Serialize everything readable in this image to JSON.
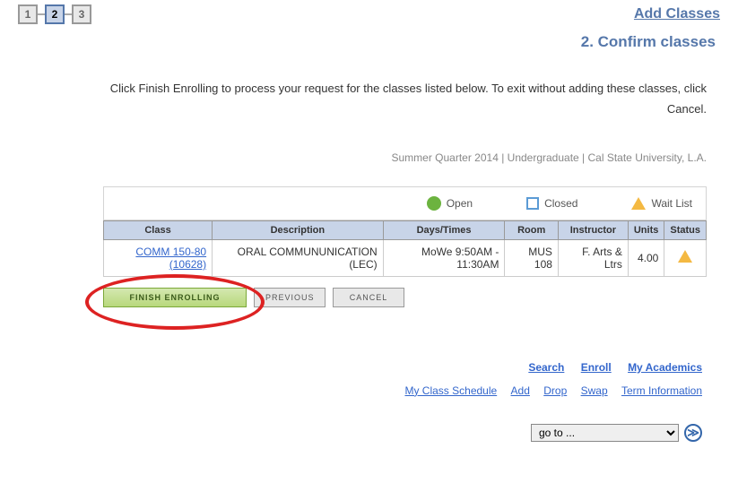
{
  "header": {
    "title": "Add Classes",
    "steps": [
      "1",
      "2",
      "3"
    ],
    "activeStep": 1
  },
  "subtitle": "2.  Confirm classes",
  "instructions": "Click Finish Enrolling to process your request for the classes listed below. To exit without adding these classes, click Cancel.",
  "termInfo": "Summer Quarter 2014 | Undergraduate | Cal State University, L.A.",
  "legend": {
    "open": "Open",
    "closed": "Closed",
    "waitlist": "Wait List"
  },
  "table": {
    "headers": {
      "class": "Class",
      "description": "Description",
      "daysTimes": "Days/Times",
      "room": "Room",
      "instructor": "Instructor",
      "units": "Units",
      "status": "Status"
    },
    "rows": [
      {
        "class": "COMM 150-80 (10628)",
        "description": "ORAL COMMUNUNICATION (LEC)",
        "daysTimes": "MoWe 9:50AM - 11:30AM",
        "room": "MUS 108",
        "instructor": "F. Arts & Ltrs",
        "units": "4.00",
        "status": "waitlist"
      }
    ]
  },
  "buttons": {
    "cancel": "CANCEL",
    "previous": "PREVIOUS",
    "finish": "FINISH ENROLLING"
  },
  "footer": {
    "row1": [
      "Search",
      "Enroll",
      "My Academics"
    ],
    "row2": [
      "My Class Schedule",
      "Add",
      "Drop",
      "Swap",
      "Term Information"
    ]
  },
  "goto": {
    "placeholder": "go to ..."
  }
}
